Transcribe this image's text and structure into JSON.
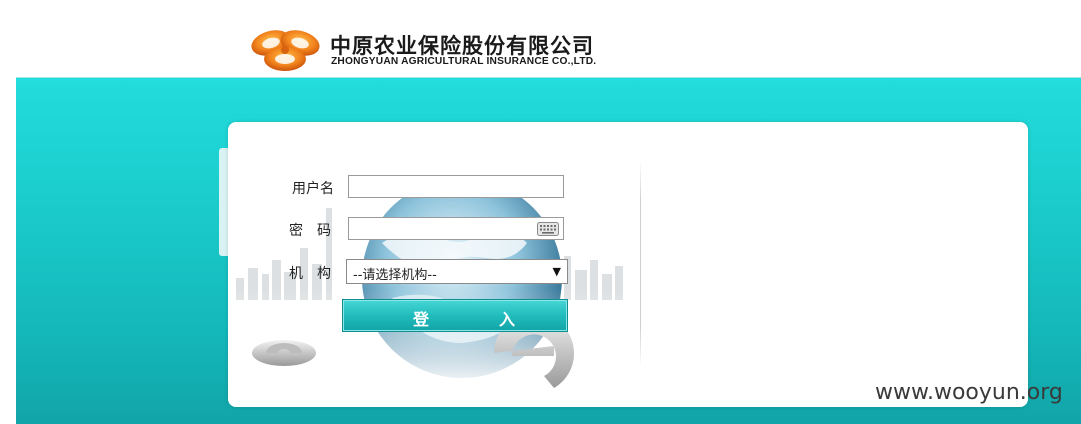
{
  "header": {
    "company_name_cn": "中原农业保险股份有限公司",
    "company_name_en": "ZHONGYUAN AGRICULTURAL INSURANCE CO.,LTD."
  },
  "login": {
    "username_label": "用户名",
    "password_label": "密码",
    "org_label": "机构",
    "username_value": "",
    "password_value": "",
    "org_selected": "--请选择机构--",
    "submit_label": "登入",
    "keyboard_icon": "keyboard-icon"
  },
  "watermark": "www.wooyun.org",
  "colors": {
    "band_top": "#23dcdc",
    "band_bottom": "#11a4a8",
    "button": "#22bcbd",
    "logo_orange": "#f07a1a"
  }
}
